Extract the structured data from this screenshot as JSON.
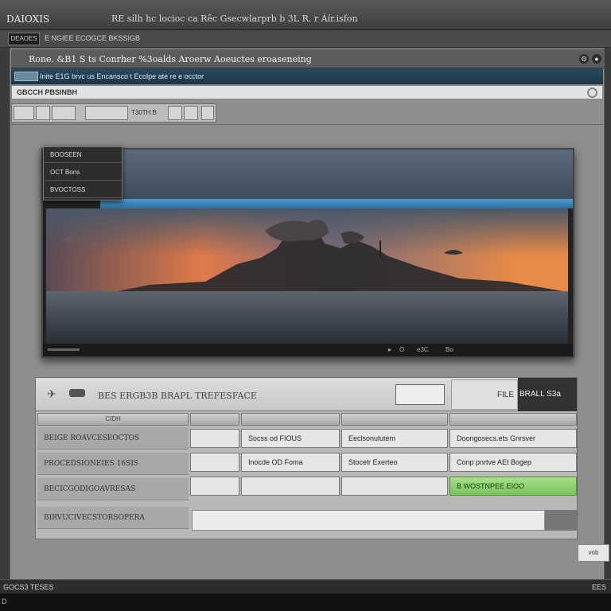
{
  "window": {
    "app_title": "DAIOXIS",
    "title": "RE sílh hc locioc ca Rêc Gsecwlarprb b 3L R. r Áír.isfon"
  },
  "menubar": {
    "active": "DEAOES",
    "items": "E NGIEE ECOGCE BKSSIGB"
  },
  "address": {
    "text": "Rone. &B1 S ts Conrher %3oalds Aroerw Aoeuctes eroaseneing"
  },
  "blue_bar": {
    "text": "Inite  E1G brvc us Encansco t  Ecolpe ate re  e  occtor"
  },
  "search": {
    "label": "GBCCH PBSINBH"
  },
  "toolbar": {
    "label": "T30TH B"
  },
  "dropdown": {
    "items": [
      "BOOSEEN",
      "OCT Bons",
      "BVOCTOSS"
    ]
  },
  "viewer": {
    "controls": [
      "O",
      "e3C",
      "Bo"
    ]
  },
  "lower": {
    "title": "BES ERGB3B BRAPL",
    "title2": "TREFESFACE",
    "card": "FILE",
    "dark": "BRALL  S3a",
    "columns": [
      "CIDH",
      "",
      "",
      "",
      ""
    ],
    "row_labels": [
      "BEIGE ROAVCESEOCTOS",
      "PROCEDSIONEIES 16SIS",
      "BECICGODIGOAVRESAS",
      "BIRVUCIVECSTORSOPERA"
    ],
    "rows": [
      [
        "",
        "Socss od FIOUS",
        "Eeclsonulutem",
        "Doongosecs.ets  Gnrsver"
      ],
      [
        "",
        "Inocde OD Foma",
        "Stocelr Exerteo",
        "Conp pnrtve  AEt  Bogep"
      ],
      [
        "",
        "",
        "",
        "B  WOSTNPEE EIOO"
      ]
    ]
  },
  "corner_btn": "vob",
  "status": {
    "left": "GOCS3 TESES",
    "right": "EES"
  },
  "taskbar": {
    "text": "D"
  }
}
